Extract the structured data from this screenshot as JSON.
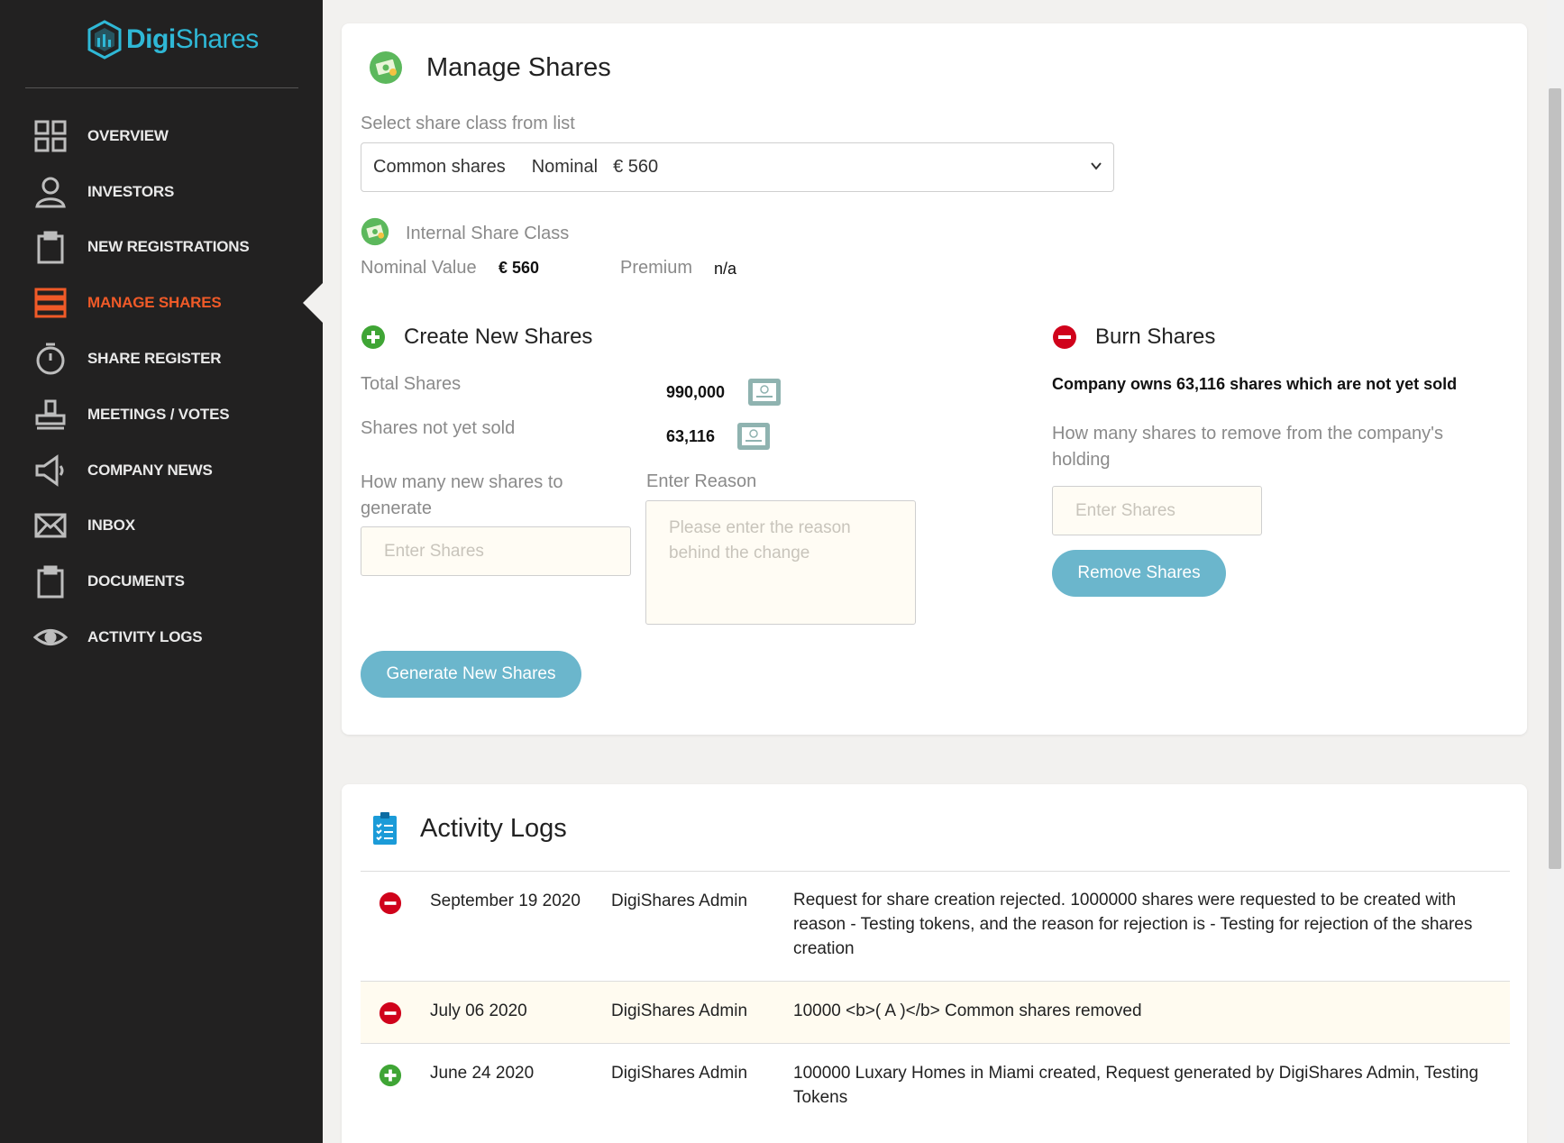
{
  "brand": {
    "name_bold": "Digi",
    "name_light": "Shares"
  },
  "sidebar": {
    "items": [
      {
        "label": "OVERVIEW",
        "icon": "grid-icon"
      },
      {
        "label": "INVESTORS",
        "icon": "user-icon"
      },
      {
        "label": "NEW REGISTRATIONS",
        "icon": "clipboard-icon"
      },
      {
        "label": "MANAGE SHARES",
        "icon": "list-icon",
        "active": true
      },
      {
        "label": "SHARE REGISTER",
        "icon": "stopwatch-icon"
      },
      {
        "label": "MEETINGS / VOTES",
        "icon": "stamp-icon"
      },
      {
        "label": "COMPANY NEWS",
        "icon": "megaphone-icon"
      },
      {
        "label": "INBOX",
        "icon": "envelope-icon"
      },
      {
        "label": "DOCUMENTS",
        "icon": "clipboard-icon"
      },
      {
        "label": "ACTIVITY LOGS",
        "icon": "eye-icon"
      }
    ]
  },
  "manage": {
    "title": "Manage Shares",
    "select_label": "Select share class from list",
    "select_value_name": "Common shares",
    "select_value_nominal": "Nominal",
    "select_value_amount": "€ 560",
    "class_name": "Internal Share Class",
    "nominal_label": "Nominal Value",
    "nominal_value": "€ 560",
    "premium_label": "Premium",
    "premium_value": "n/a"
  },
  "create": {
    "title": "Create New Shares",
    "total_label": "Total Shares",
    "total_value": "990,000",
    "notsold_label": "Shares not yet sold",
    "notsold_value": "63,116",
    "howmany_label": "How many new shares to generate",
    "input_placeholder": "Enter Shares",
    "reason_label": "Enter Reason",
    "reason_placeholder": "Please enter the reason behind the change",
    "button": "Generate New Shares"
  },
  "burn": {
    "title": "Burn Shares",
    "owns_text": "Company owns 63,116 shares which are not yet sold",
    "howmany_label": "How many shares to remove from the company's holding",
    "input_placeholder": "Enter Shares",
    "button": "Remove Shares"
  },
  "logs": {
    "title": "Activity Logs",
    "rows": [
      {
        "type": "remove",
        "date": "September 19 2020",
        "user": "DigiShares Admin",
        "message": "Request for share creation rejected. 1000000 shares were requested to be created with reason - Testing tokens, and the reason for rejection is - Testing for rejection of the shares creation"
      },
      {
        "type": "remove",
        "date": "July 06 2020",
        "user": "DigiShares Admin",
        "message": "10000 <b>( A )</b> Common shares removed"
      },
      {
        "type": "add",
        "date": "June 24 2020",
        "user": "DigiShares Admin",
        "message": "100000 Luxary Homes in Miami created, Request generated by DigiShares Admin, Testing Tokens"
      }
    ]
  },
  "colors": {
    "accent": "#f05a28",
    "brand": "#2fb8d6",
    "button": "#6bb6cc",
    "remove": "#d0021b",
    "add": "#3fa535"
  }
}
